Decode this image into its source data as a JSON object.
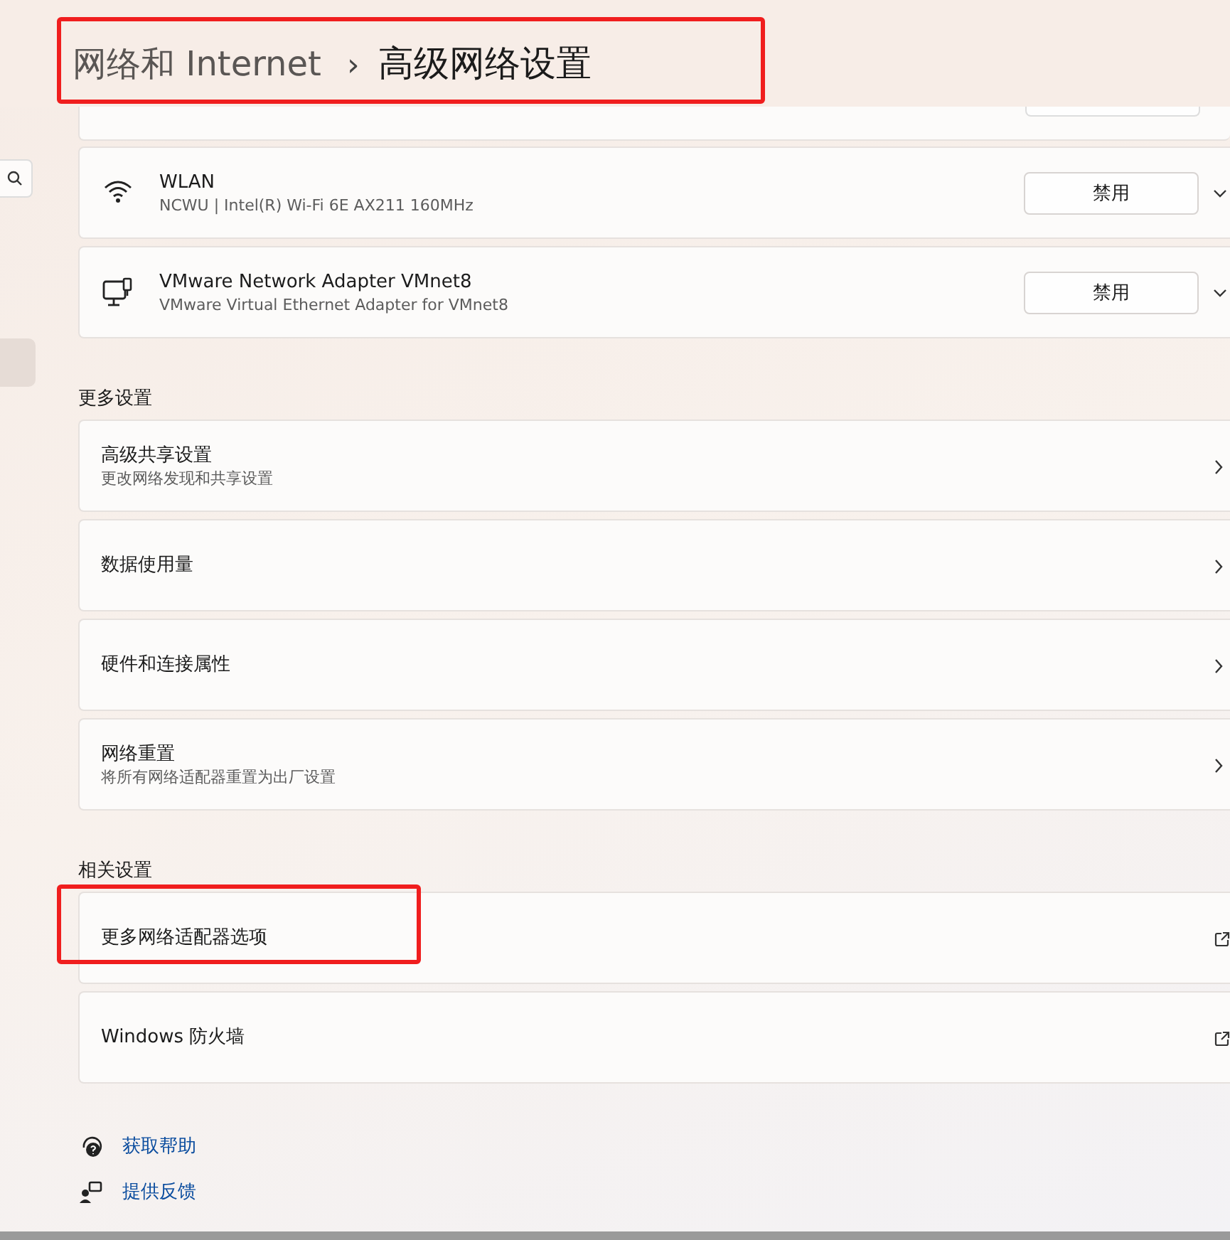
{
  "header": {
    "parent": "网络和 Internet",
    "separator": "›",
    "title": "高级网络设置",
    "annotated": true
  },
  "adapters": [
    {
      "kind": "wifi",
      "name": "WLAN",
      "description": "NCWU | Intel(R) Wi-Fi 6E AX211 160MHz",
      "button": "禁用"
    },
    {
      "kind": "monitor",
      "name": "VMware Network Adapter VMnet8",
      "description": "VMware Virtual Ethernet Adapter for VMnet8",
      "button": "禁用"
    }
  ],
  "sections": [
    {
      "heading": "更多设置",
      "items": [
        {
          "title": "高级共享设置",
          "subtitle": "更改网络发现和共享设置",
          "kind": "page",
          "annotated": false
        },
        {
          "title": "数据使用量",
          "kind": "page",
          "annotated": false
        },
        {
          "title": "硬件和连接属性",
          "kind": "page",
          "annotated": false
        },
        {
          "title": "网络重置",
          "subtitle": "将所有网络适配器重置为出厂设置",
          "kind": "page",
          "annotated": false
        }
      ]
    },
    {
      "heading": "相关设置",
      "items": [
        {
          "title": "更多网络适配器选项",
          "kind": "external",
          "annotated": true
        },
        {
          "title": "Windows 防火墙",
          "kind": "external",
          "annotated": false
        }
      ]
    }
  ],
  "links": [
    {
      "kind": "help",
      "text": "获取帮助"
    },
    {
      "kind": "feedback",
      "text": "提供反馈"
    }
  ]
}
